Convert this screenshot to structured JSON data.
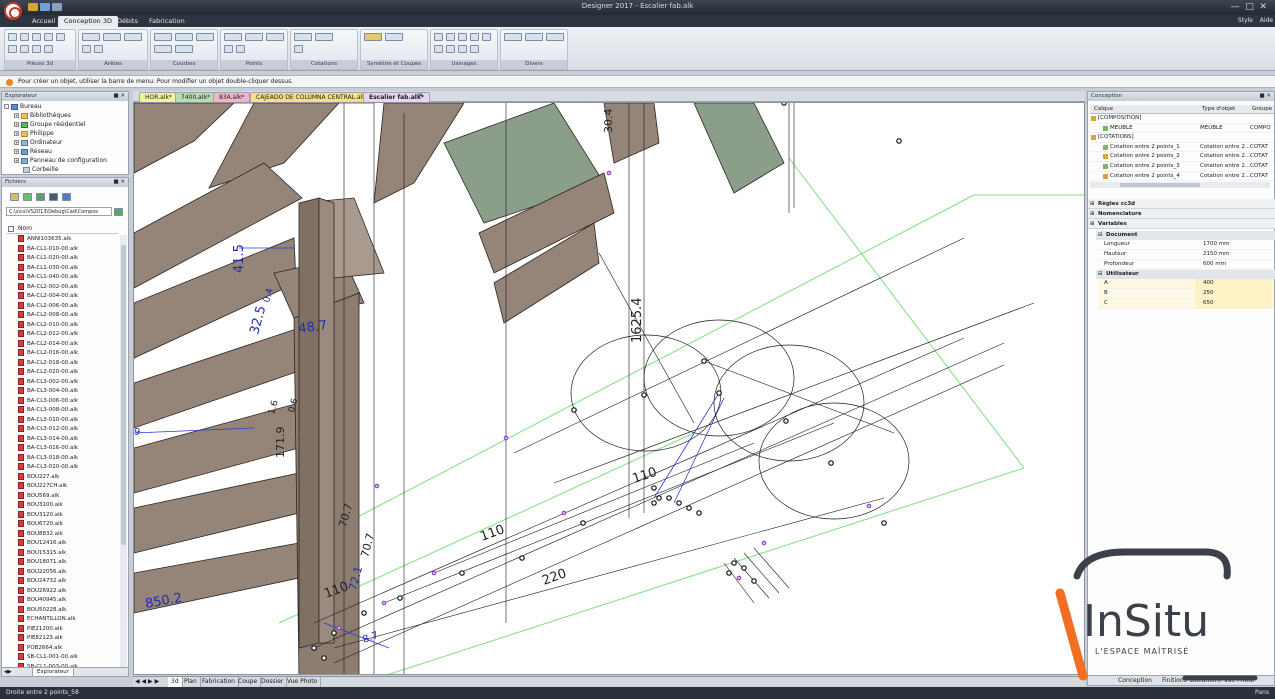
{
  "window": {
    "title": "Designer 2017 - Escalier fab.alk",
    "menu_style": "Style",
    "menu_help": "Aide"
  },
  "ribbon_tabs": [
    {
      "label": "Accueil"
    },
    {
      "label": "Conception 3D",
      "active": true
    },
    {
      "label": "Débits"
    },
    {
      "label": "Fabrication"
    }
  ],
  "ribbon_groups": [
    {
      "label": "Pièces 3d"
    },
    {
      "label": "Arêtes"
    },
    {
      "label": "Courbes"
    },
    {
      "label": "Points"
    },
    {
      "label": "Cotations"
    },
    {
      "label": "Symétrie et Coupes"
    },
    {
      "label": "Usinages"
    },
    {
      "label": "Divers"
    }
  ],
  "hint_text": "Pour créer un objet, utiliser la barre de menu. Pour modifier un objet double-cliquer dessus.",
  "explorer": {
    "title": "Explorateur",
    "items": [
      {
        "label": "Bureau",
        "level": 0
      },
      {
        "label": "Bibliothèques",
        "level": 1
      },
      {
        "label": "Groupe résidentiel",
        "level": 1
      },
      {
        "label": "Philippe",
        "level": 1
      },
      {
        "label": "Ordinateur",
        "level": 1
      },
      {
        "label": "Réseau",
        "level": 1
      },
      {
        "label": "Panneau de configuration",
        "level": 1
      },
      {
        "label": "Corbeille",
        "level": 1
      }
    ]
  },
  "folders": {
    "title": "Fichiers",
    "path": "C:\\s\\cs\\VS2013\\Debug\\Cad\\Compos",
    "column_name": "Nom",
    "files": [
      "ANNI103635.alk",
      "BA-CL1-010-00.alk",
      "BA-CL1-020-00.alk",
      "BA-CL1-030-00.alk",
      "BA-CL1-040-00.alk",
      "BA-CL2-002-00.alk",
      "BA-CL2-004-00.alk",
      "BA-CL2-006-00.alk",
      "BA-CL2-008-00.alk",
      "BA-CL2-010-00.alk",
      "BA-CL2-012-00.alk",
      "BA-CL2-014-00.alk",
      "BA-CL2-016-00.alk",
      "BA-CL2-018-00.alk",
      "BA-CL2-020-00.alk",
      "BA-CL3-002-00.alk",
      "BA-CL3-004-00.alk",
      "BA-CL3-006-00.alk",
      "BA-CL3-008-00.alk",
      "BA-CL3-010-00.alk",
      "BA-CL3-012-00.alk",
      "BA-CL3-014-00.alk",
      "BA-CL3-016-00.alk",
      "BA-CL3-018-00.alk",
      "BA-CL3-020-00.alk",
      "BOU227.alk",
      "BOU227CH.alk",
      "BOU569.alk",
      "BOU3100.alk",
      "BOU3120.alk",
      "BOU6720.alk",
      "BOU8832.alk",
      "BOU12416.alk",
      "BOU15315.alk",
      "BOU18071.alk",
      "BOU22056.alk",
      "BOU24732.alk",
      "BOU26922.alk",
      "BOU40945.alk",
      "BOU50228.alk",
      "ECHANTILLON.alk",
      "PIE21200.alk",
      "PIE82123.alk",
      "POB2664.alk",
      "SB-CL1-001-00.alk",
      "SB-CL1-003-00.alk"
    ],
    "tab_label": "Explorateur"
  },
  "doc_tabs": [
    {
      "label": "HOR.alk*",
      "color": "#f3f39a"
    },
    {
      "label": "7400.alk*",
      "color": "#b8ddb3"
    },
    {
      "label": "83A.alk*",
      "color": "#f0b6c7"
    },
    {
      "label": "CAJEADO DE COLUMNA CENTRAL.alk*",
      "color": "#f4e184"
    },
    {
      "label": "Escalier fab.alk*",
      "color": "#e6d6f1",
      "active": true
    }
  ],
  "dimensions": [
    "30.4",
    "41.5",
    "32.5",
    "48.7",
    "1625.4",
    "110",
    "110",
    "220",
    "110",
    "850.2",
    "70.7",
    "70.7",
    "171.9",
    "72.1",
    "1.6",
    "0.6",
    "9",
    "0.4",
    "8.7"
  ],
  "view_tabs": [
    "3d",
    "Plan",
    "Fabrication",
    "Coupe",
    "Dossier",
    "Vue Photo"
  ],
  "status_text": "Droite entre 2 points_58",
  "status_right": "Pans",
  "conception": {
    "title": "Conception",
    "columns": [
      "Calque",
      "Type d'objet",
      "Groupe"
    ],
    "rows": [
      {
        "name": "[COMPOSITION]",
        "type": "",
        "group": ""
      },
      {
        "name": "MEUBLE",
        "type": "MEUBLE",
        "group": "COMPO"
      },
      {
        "name": "[COTATIONS]",
        "type": "",
        "group": ""
      },
      {
        "name": "Cotation entre 2 points_1",
        "type": "Cotation entre 2...",
        "group": "COTAT"
      },
      {
        "name": "Cotation entre 2 points_2",
        "type": "Cotation entre 2...",
        "group": "COTAT"
      },
      {
        "name": "Cotation entre 2 points_3",
        "type": "Cotation entre 2...",
        "group": "COTAT"
      },
      {
        "name": "Cotation entre 2 points_4",
        "type": "Cotation entre 2...",
        "group": "COTAT"
      }
    ]
  },
  "properties": {
    "sections": [
      "Règles cc3d",
      "Nomenclature",
      "Variables"
    ],
    "document_label": "Document",
    "document_vars": [
      {
        "name": "Longueur",
        "value": "1700 mm"
      },
      {
        "name": "Hauteur",
        "value": "2150 mm"
      },
      {
        "name": "Profondeur",
        "value": "600 mm"
      }
    ],
    "user_label": "Utilisateur",
    "user_vars": [
      {
        "name": "A",
        "value": "400"
      },
      {
        "name": "B",
        "value": "250"
      },
      {
        "name": "C",
        "value": "650"
      }
    ]
  },
  "right_tabs": [
    "Conception",
    "Finitions",
    "Document",
    "Vue Photo"
  ],
  "watermark": {
    "brand": "InSitu",
    "tagline": "L'ESPACE MAÎTRISÉ"
  }
}
